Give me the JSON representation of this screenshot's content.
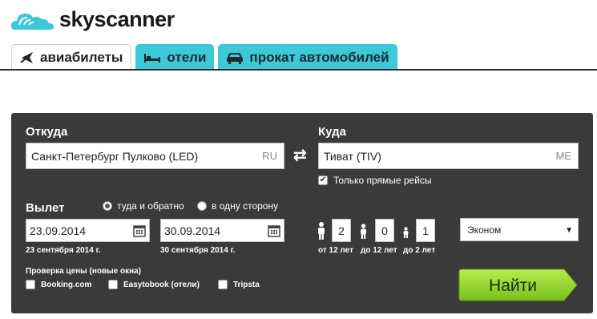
{
  "brand": {
    "name": "skyscanner"
  },
  "tabs": [
    {
      "label": "авиабилеты",
      "icon": "plane-icon"
    },
    {
      "label": "отели",
      "icon": "bed-icon"
    },
    {
      "label": "прокат автомобилей",
      "icon": "car-icon"
    }
  ],
  "form": {
    "from_label": "Откуда",
    "from_value": "Санкт-Петербург Пулково (LED)",
    "from_code": "RU",
    "to_label": "Куда",
    "to_value": "Тиват (TIV)",
    "to_code": "ME",
    "direct_only_label": "Только прямые рейсы",
    "depart_label": "Вылет",
    "trip_roundtrip": "туда и обратно",
    "trip_oneway": "в одну сторону",
    "depart_date": "23.09.2014",
    "depart_date_text": "23 сентября 2014 г.",
    "return_date": "30.09.2014",
    "return_date_text": "30 сентября 2014 г.",
    "adults": "2",
    "children": "0",
    "infants": "1",
    "adults_label": "от 12 лет",
    "children_label": "до 12 лет",
    "infants_label": "до 2 лет",
    "cabin_class": "Эконом",
    "price_check_label": "Проверка цены (новые окна)",
    "providers": [
      "Booking.com",
      "Easytobook (отели)",
      "Tripsta"
    ],
    "search_label": "Найти"
  },
  "colors": {
    "accent": "#3dc8d8",
    "panel": "#3a3a3a",
    "button": "#8fd12a"
  }
}
